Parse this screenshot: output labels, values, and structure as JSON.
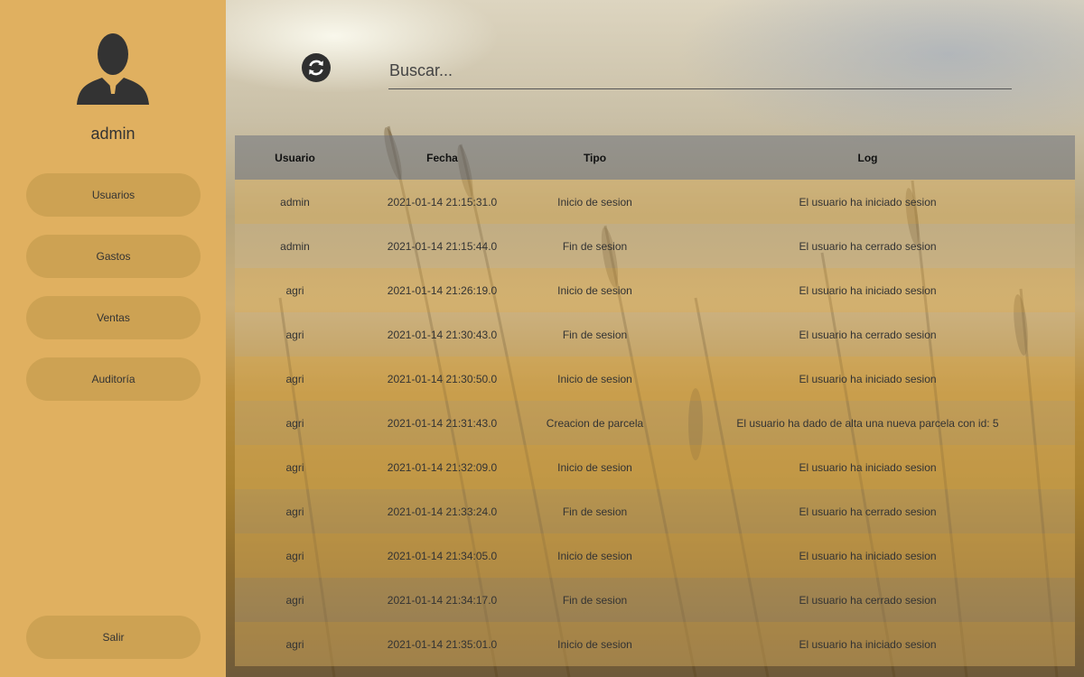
{
  "sidebar": {
    "username": "admin",
    "nav": [
      {
        "label": "Usuarios"
      },
      {
        "label": "Gastos"
      },
      {
        "label": "Ventas"
      },
      {
        "label": "Auditoría"
      }
    ],
    "logout_label": "Salir"
  },
  "toolbar": {
    "refresh_icon": "refresh-icon",
    "search_placeholder": "Buscar..."
  },
  "table": {
    "headers": [
      "Usuario",
      "Fecha",
      "Tipo",
      "Log"
    ],
    "rows": [
      [
        "admin",
        "2021-01-14 21:15:31.0",
        "Inicio de sesion",
        "El usuario ha iniciado sesion"
      ],
      [
        "admin",
        "2021-01-14 21:15:44.0",
        "Fin de sesion",
        "El usuario ha cerrado sesion"
      ],
      [
        "agri",
        "2021-01-14 21:26:19.0",
        "Inicio de sesion",
        "El usuario ha iniciado sesion"
      ],
      [
        "agri",
        "2021-01-14 21:30:43.0",
        "Fin de sesion",
        "El usuario ha cerrado sesion"
      ],
      [
        "agri",
        "2021-01-14 21:30:50.0",
        "Inicio de sesion",
        "El usuario ha iniciado sesion"
      ],
      [
        "agri",
        "2021-01-14 21:31:43.0",
        "Creacion de parcela",
        "El usuario ha dado de alta una nueva parcela con id: 5"
      ],
      [
        "agri",
        "2021-01-14 21:32:09.0",
        "Inicio de sesion",
        "El usuario ha iniciado sesion"
      ],
      [
        "agri",
        "2021-01-14 21:33:24.0",
        "Fin de sesion",
        "El usuario ha cerrado sesion"
      ],
      [
        "agri",
        "2021-01-14 21:34:05.0",
        "Inicio de sesion",
        "El usuario ha iniciado sesion"
      ],
      [
        "agri",
        "2021-01-14 21:34:17.0",
        "Fin de sesion",
        "El usuario ha cerrado sesion"
      ],
      [
        "agri",
        "2021-01-14 21:35:01.0",
        "Inicio de sesion",
        "El usuario ha iniciado sesion"
      ]
    ]
  },
  "colors": {
    "sidebar_bg": "#e0b060",
    "button_bg": "#cda253"
  }
}
